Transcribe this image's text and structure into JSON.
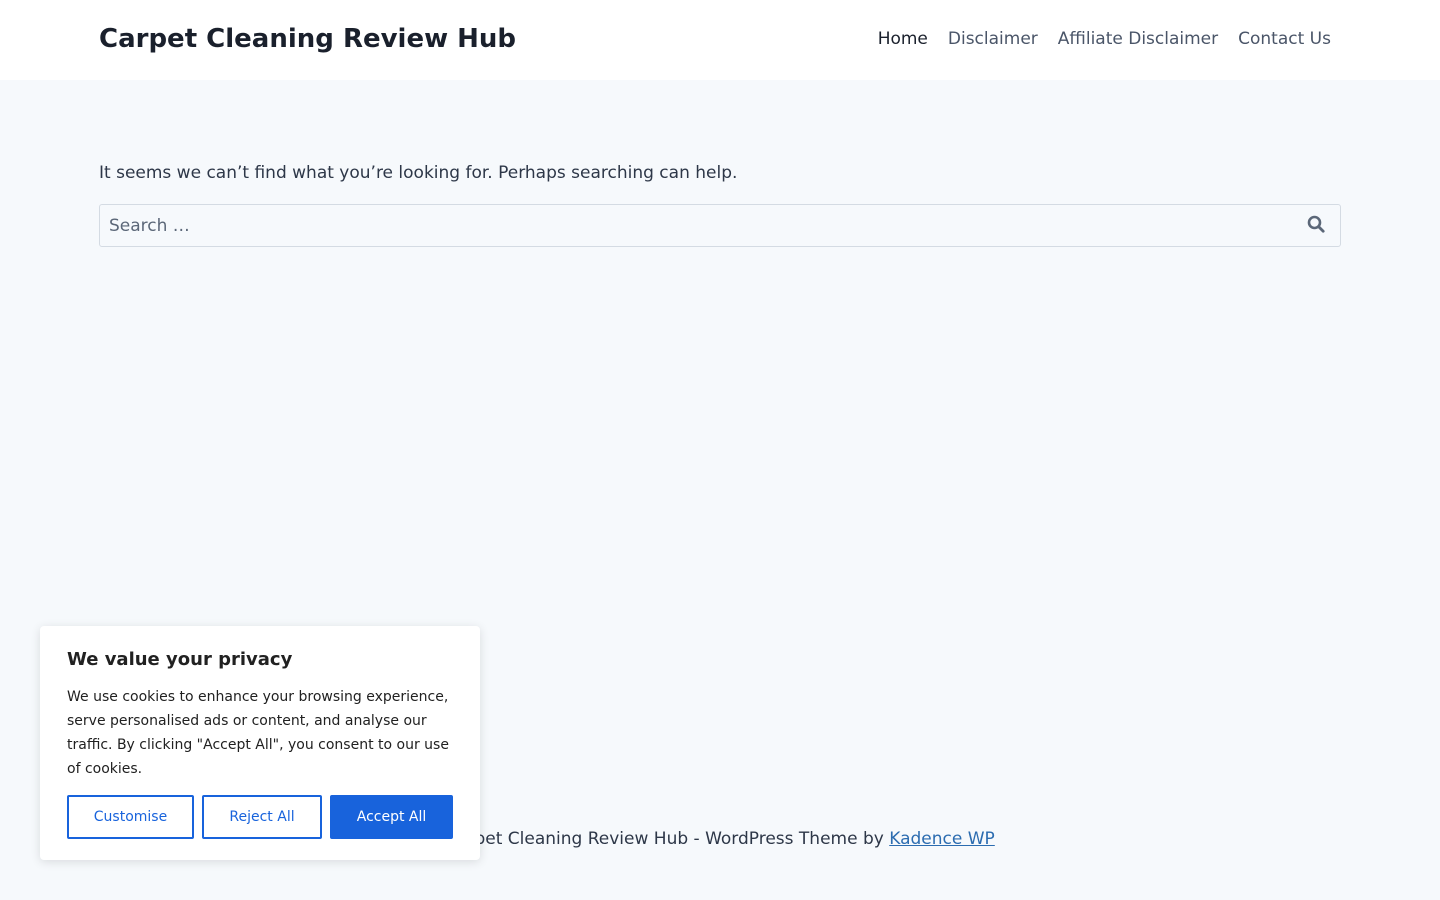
{
  "header": {
    "site_title": "Carpet Cleaning Review Hub",
    "nav": [
      {
        "label": "Home",
        "active": true
      },
      {
        "label": "Disclaimer",
        "active": false
      },
      {
        "label": "Affiliate Disclaimer",
        "active": false
      },
      {
        "label": "Contact Us",
        "active": false
      }
    ]
  },
  "main": {
    "message": "It seems we can’t find what you’re looking for. Perhaps searching can help.",
    "search": {
      "placeholder": "Search …",
      "value": "",
      "icon": "search-icon"
    }
  },
  "footer": {
    "prefix": "Carpet Cleaning Review Hub - WordPress Theme by ",
    "link_text": "Kadence WP"
  },
  "cookie_banner": {
    "title": "We value your privacy",
    "text": "We use cookies to enhance your browsing experience, serve personalised ads or content, and analyse our traffic. By clicking \"Accept All\", you consent to our use of cookies.",
    "customise_label": "Customise",
    "reject_label": "Reject All",
    "accept_label": "Accept All"
  },
  "colors": {
    "page_background": "#f6f9fc",
    "accent": "#1863dc",
    "footer_link": "#2b6cb0",
    "title_text": "#1a202c"
  }
}
